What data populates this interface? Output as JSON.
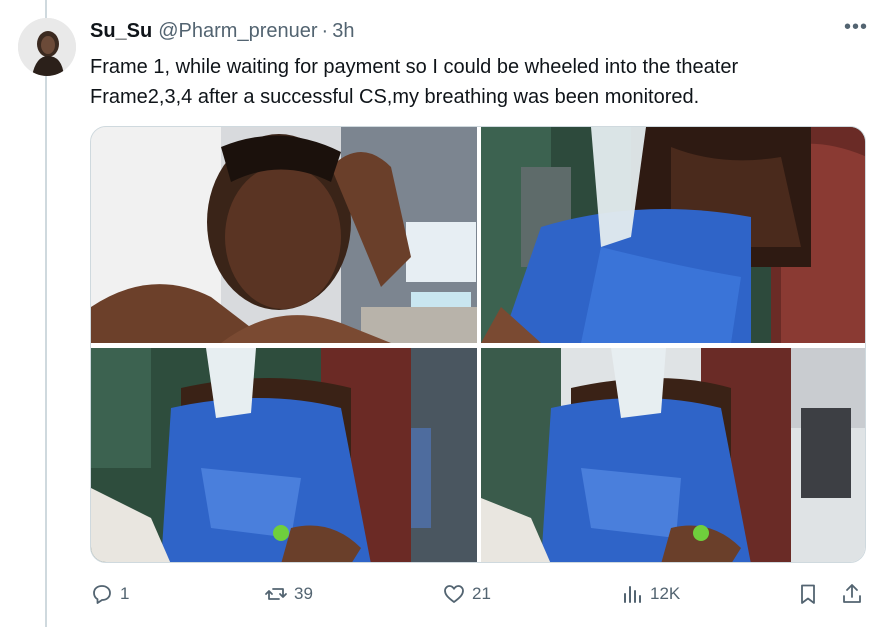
{
  "tweet": {
    "display_name": "Su_Su",
    "handle": "@Pharm_prenuer",
    "separator": "·",
    "time": "3h",
    "more_label": "•••",
    "text_lines": [
      "Frame 1, while waiting for payment so I could be wheeled into the theater",
      "Frame2,3,4 after a successful CS,my breathing was been monitored."
    ]
  },
  "actions": {
    "replies": "1",
    "reposts": "39",
    "likes": "21",
    "views": "12K"
  },
  "colors": {
    "secondary_text": "#536471",
    "border": "#cfd9de",
    "gown_blue": "#2f64c8"
  }
}
